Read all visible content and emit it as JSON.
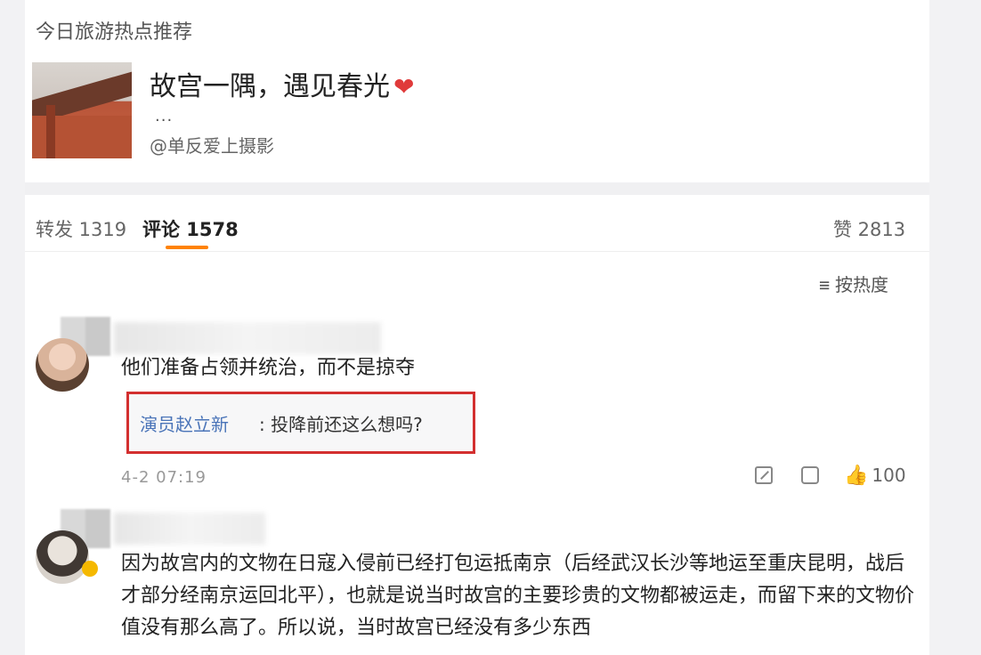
{
  "header": {
    "title": "今日旅游热点推荐"
  },
  "post": {
    "title": "故宫一隅，遇见春光",
    "heart": "❤",
    "more": "...",
    "author": "@单反爱上摄影"
  },
  "tabs": [
    {
      "label": "转发 1319"
    },
    {
      "label": "评论 1578"
    },
    {
      "label": "赞 2813"
    }
  ],
  "sort": {
    "icon": "≡",
    "label": "按热度"
  },
  "comments": [
    {
      "text": "他们准备占领并统治，而不是掠夺",
      "reply": {
        "user": "演员赵立新",
        "text": ": 投降前还这么想吗?"
      },
      "time": "4-2 07:19",
      "likes": "100"
    },
    {
      "text": "因为故宫内的文物在日寇入侵前已经打包运抵南京（后经武汉长沙等地运至重庆昆明，战后才部分经南京运回北平），也就是说当时故宫的主要珍贵的文物都被运走，而留下来的文物价值没有那么高了。所以说，当时故宫已经没有多少东西"
    }
  ]
}
